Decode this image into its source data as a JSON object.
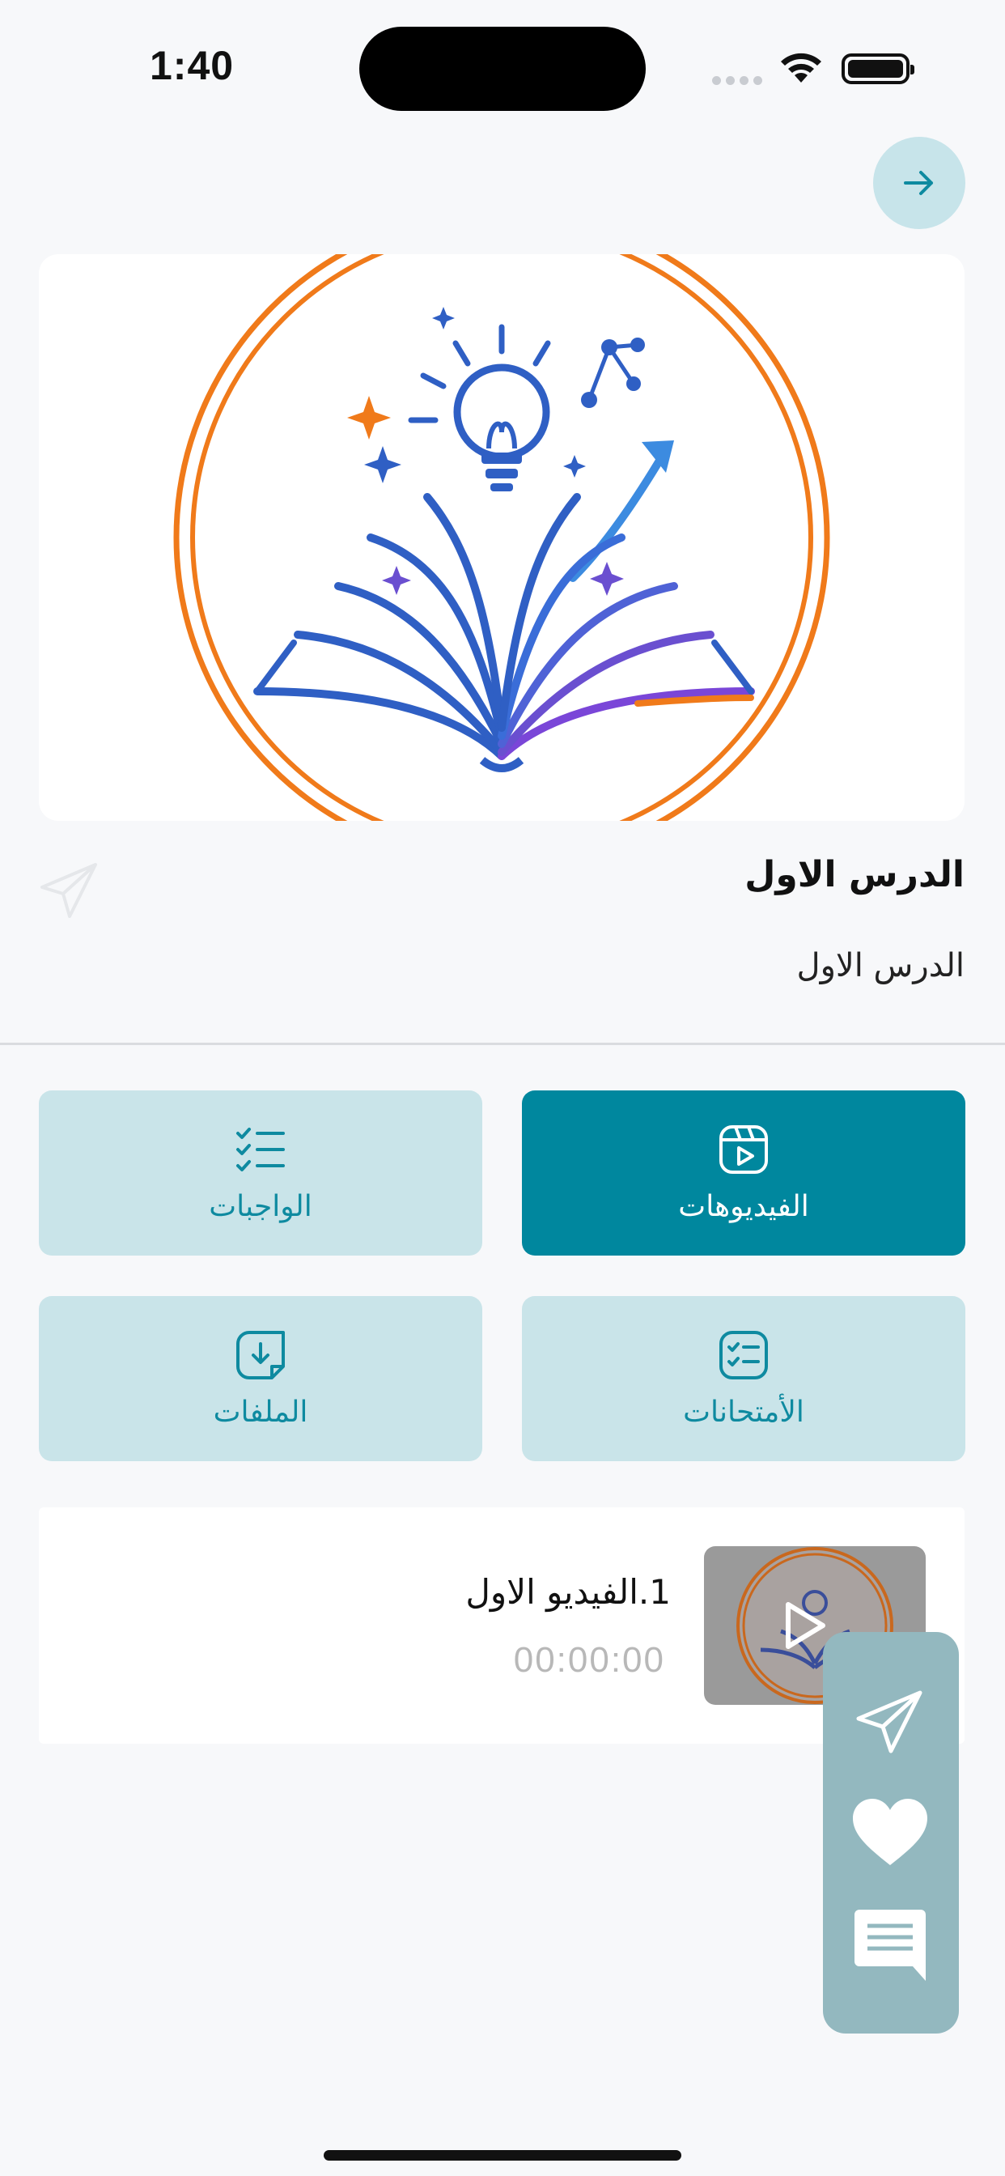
{
  "status_bar": {
    "time": "1:40"
  },
  "lesson": {
    "title": "الدرس الاول",
    "subtitle": "الدرس الاول"
  },
  "tabs": [
    {
      "label": "الفيديوهات",
      "icon": "video-icon",
      "active": true
    },
    {
      "label": "الواجبات",
      "icon": "checklist-icon",
      "active": false
    },
    {
      "label": "الأمتحانات",
      "icon": "exam-icon",
      "active": false
    },
    {
      "label": "الملفات",
      "icon": "file-download-icon",
      "active": false
    }
  ],
  "video": {
    "title": "1.الفيديو الاول",
    "duration": "00:00:00"
  },
  "colors": {
    "accent": "#00879e",
    "tab_inactive_bg": "#c9e4e9",
    "fab_panel_bg": "#93b8bf",
    "logo_orange": "#f07a1a",
    "logo_blue": "#2f5fc4"
  }
}
